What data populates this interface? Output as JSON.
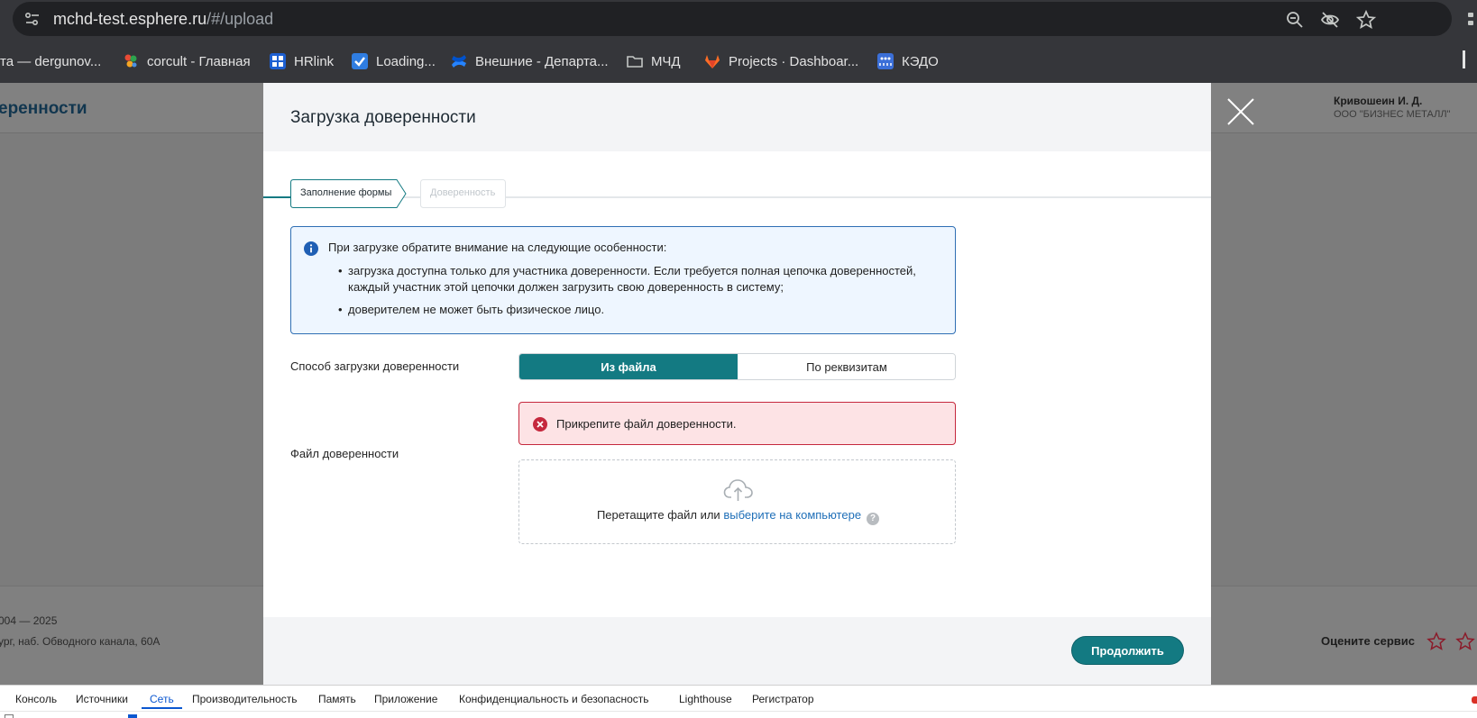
{
  "browser": {
    "url_host": "mchd-test.esphere.ru",
    "url_path": "/#/upload",
    "bookmarks": [
      {
        "label": "та — dergunov...",
        "icon": "none"
      },
      {
        "label": "corcult - Главная",
        "icon": "corcult-icon"
      },
      {
        "label": "HRlink",
        "icon": "hrlink-icon"
      },
      {
        "label": "Loading...",
        "icon": "loading-icon"
      },
      {
        "label": "Внешние - Департа...",
        "icon": "confluence-icon"
      },
      {
        "label": "МЧД",
        "icon": "folder-icon"
      },
      {
        "label": "Projects · Dashboar...",
        "icon": "gitlab-icon"
      },
      {
        "label": "КЭДО",
        "icon": "kedo-icon"
      }
    ]
  },
  "page": {
    "title": "еренности",
    "user_name": "Кривошеин И. Д.",
    "user_org": "ООО \"БИЗНЕС МЕТАЛЛ\"",
    "footer_copy": "004 — 2025",
    "footer_address": "ург, наб. Обводного канала, 60А",
    "rate_label": "Оцените сервис"
  },
  "modal": {
    "title": "Загрузка доверенности",
    "steps": [
      {
        "label": "Заполнение формы",
        "state": "active"
      },
      {
        "label": "Доверенность",
        "state": "disabled"
      }
    ],
    "info": {
      "heading": "При загрузке обратите внимание на следующие особенности:",
      "bullet1_line1": "загрузка доступна только для участника доверенности. Если требуется полная цепочка доверенностей,",
      "bullet1_line2": "каждый участник этой цепочки должен загрузить свою доверенность в систему;",
      "bullet2": "доверителем не может быть физическое лицо."
    },
    "upload_method_label": "Способ загрузки доверенности",
    "upload_method_options": [
      "Из файла",
      "По реквизитам"
    ],
    "upload_method_selected": "Из файла",
    "error_text": "Прикрепите файл доверенности.",
    "file_label": "Файл доверенности",
    "drop_text": "Перетащите файл или",
    "drop_link": "выберите на компьютере",
    "help_glyph": "?",
    "continue_label": "Продолжить"
  },
  "devtools": {
    "tabs": [
      "Консоль",
      "Источники",
      "Сеть",
      "Производительность",
      "Память",
      "Приложение",
      "Конфиденциальность и безопасность",
      "Lighthouse",
      "Регистратор"
    ],
    "active_tab": "Сеть"
  },
  "colors": {
    "accent": "#137a82",
    "info_border": "#2f6fb4",
    "error_border": "#c5283d",
    "error_bg": "#fde3e5",
    "link": "#1f6fb8"
  }
}
